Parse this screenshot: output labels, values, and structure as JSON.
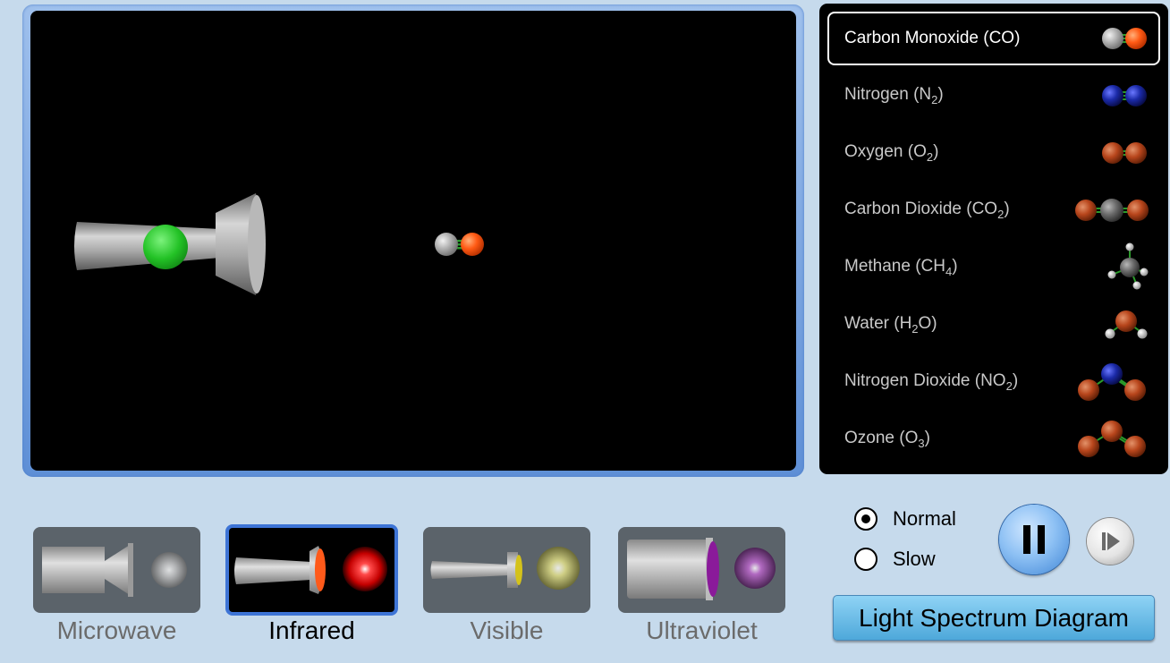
{
  "molecules": [
    {
      "label": "Carbon Monoxide (CO)",
      "selected": true
    },
    {
      "label": "Nitrogen (N",
      "sub": "2",
      "suffix": ")"
    },
    {
      "label": "Oxygen (O",
      "sub": "2",
      "suffix": ")"
    },
    {
      "label": "Carbon Dioxide (CO",
      "sub": "2",
      "suffix": ")"
    },
    {
      "label": "Methane (CH",
      "sub": "4",
      "suffix": ")"
    },
    {
      "label": "Water (H",
      "sub": "2",
      "suffix": "O)"
    },
    {
      "label": "Nitrogen Dioxide (NO",
      "sub": "2",
      "suffix": ")"
    },
    {
      "label": "Ozone (O",
      "sub": "3",
      "suffix": ")"
    }
  ],
  "light_sources": [
    {
      "label": "Microwave",
      "selected": false
    },
    {
      "label": "Infrared",
      "selected": true
    },
    {
      "label": "Visible",
      "selected": false
    },
    {
      "label": "Ultraviolet",
      "selected": false
    }
  ],
  "speed": {
    "normal_label": "Normal",
    "slow_label": "Slow",
    "selected": "Normal"
  },
  "spectrum_button_label": "Light Spectrum Diagram",
  "colors": {
    "background": "#c6daec",
    "carbon": "#9b9b9b",
    "oxygen": "#e85a1e",
    "nitrogen": "#1b2aa8",
    "emitter_on": "#27c22a"
  }
}
